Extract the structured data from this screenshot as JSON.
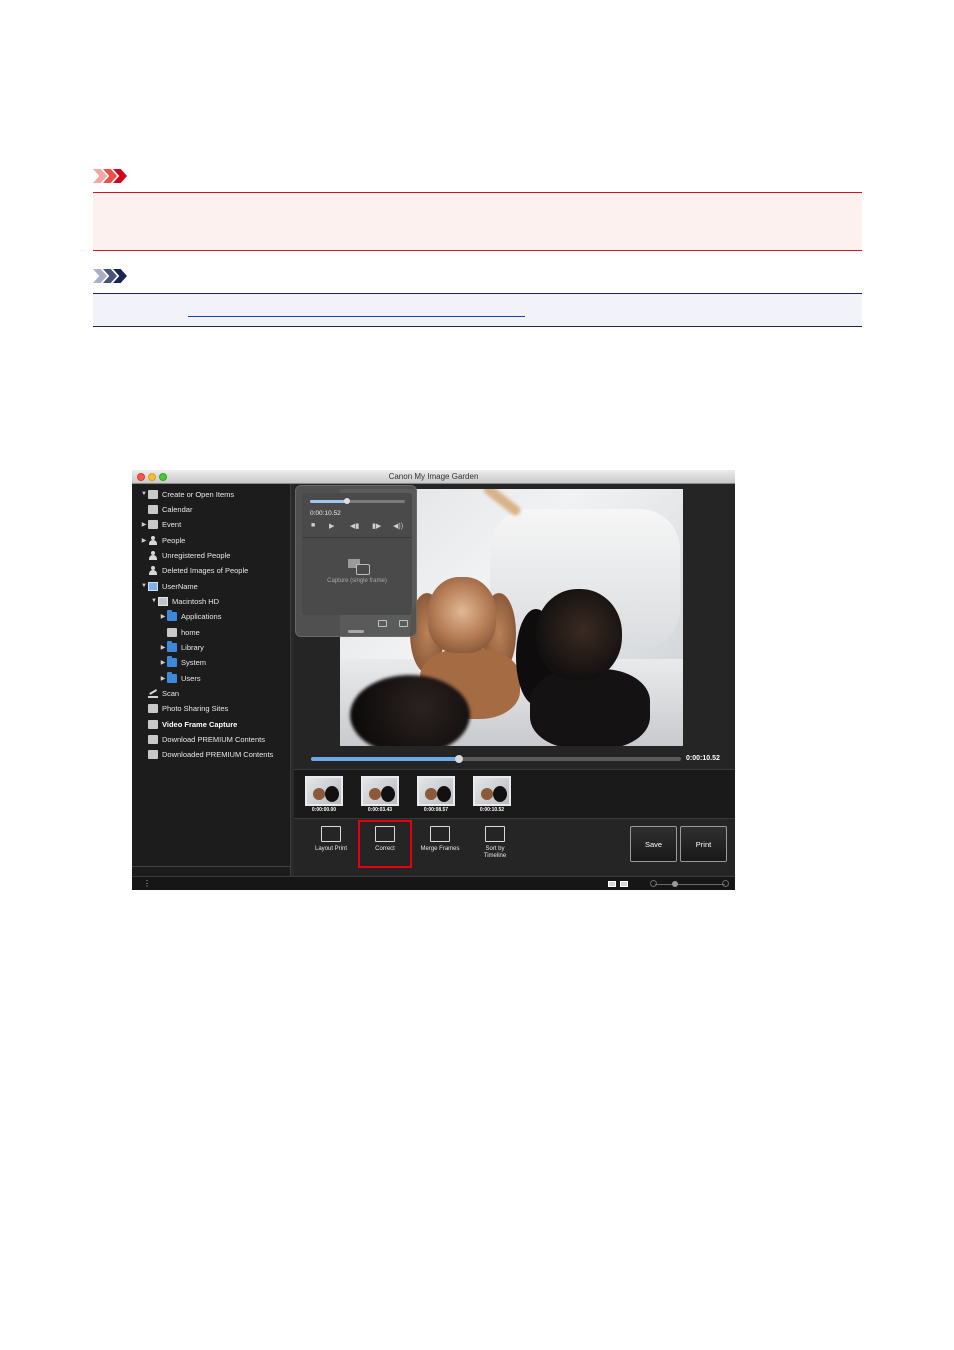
{
  "window": {
    "title": "Canon My Image Garden"
  },
  "sidebar": {
    "items": [
      {
        "label": "Create or Open Items",
        "arrow": "▼",
        "icon": "create-items-icon"
      },
      {
        "label": "Calendar",
        "arrow": "",
        "icon": "calendar-icon"
      },
      {
        "label": "Event",
        "arrow": "▶",
        "icon": "event-icon"
      },
      {
        "label": "People",
        "arrow": "▶",
        "icon": "people-icon"
      },
      {
        "label": "Unregistered People",
        "arrow": "",
        "icon": "unregistered-people-icon"
      },
      {
        "label": "Deleted Images of People",
        "arrow": "",
        "icon": "deleted-people-icon"
      },
      {
        "label": "UserName",
        "arrow": "▼",
        "icon": "computer-icon"
      },
      {
        "label": "Macintosh HD",
        "arrow": "▼",
        "icon": "hard-drive-icon"
      },
      {
        "label": "Applications",
        "arrow": "▶",
        "icon": "folder-icon"
      },
      {
        "label": "home",
        "arrow": "",
        "icon": "home-icon"
      },
      {
        "label": "Library",
        "arrow": "▶",
        "icon": "folder-icon"
      },
      {
        "label": "System",
        "arrow": "▶",
        "icon": "folder-icon"
      },
      {
        "label": "Users",
        "arrow": "▶",
        "icon": "folder-icon"
      },
      {
        "label": "Scan",
        "arrow": "",
        "icon": "scan-icon"
      },
      {
        "label": "Photo Sharing Sites",
        "arrow": "",
        "icon": "photo-sharing-icon"
      },
      {
        "label": "Video Frame Capture",
        "arrow": "",
        "icon": "video-frame-icon"
      },
      {
        "label": "Download PREMIUM Contents",
        "arrow": "",
        "icon": "download-icon"
      },
      {
        "label": "Downloaded PREMIUM Contents",
        "arrow": "",
        "icon": "downloaded-icon"
      }
    ]
  },
  "player_popup": {
    "time": "0:00:10.52",
    "capture_label": "Capture (single frame)",
    "controls": [
      "■",
      "▶",
      "◀▮",
      "▮▶",
      "◀))"
    ]
  },
  "seekbar": {
    "progress": 0.4,
    "time": "0:00:10.52"
  },
  "thumbnails": [
    {
      "time": "0:00:00.00"
    },
    {
      "time": "0:00:03.43"
    },
    {
      "time": "0:00:08.57"
    },
    {
      "time": "0:00:10.52"
    }
  ],
  "toolbar": {
    "layout_print": "Layout Print",
    "correct": "Correct",
    "merge_frames": "Merge Frames",
    "sort_by_timeline_1": "Sort by",
    "sort_by_timeline_2": "Timeline",
    "save": "Save",
    "print": "Print"
  },
  "statusbar": {
    "info_glyph": "⋮"
  },
  "colors": {
    "important_accent": "#c8192a",
    "note_accent": "#1c2550",
    "highlight": "#e60012",
    "link": "#1e3fb4"
  }
}
